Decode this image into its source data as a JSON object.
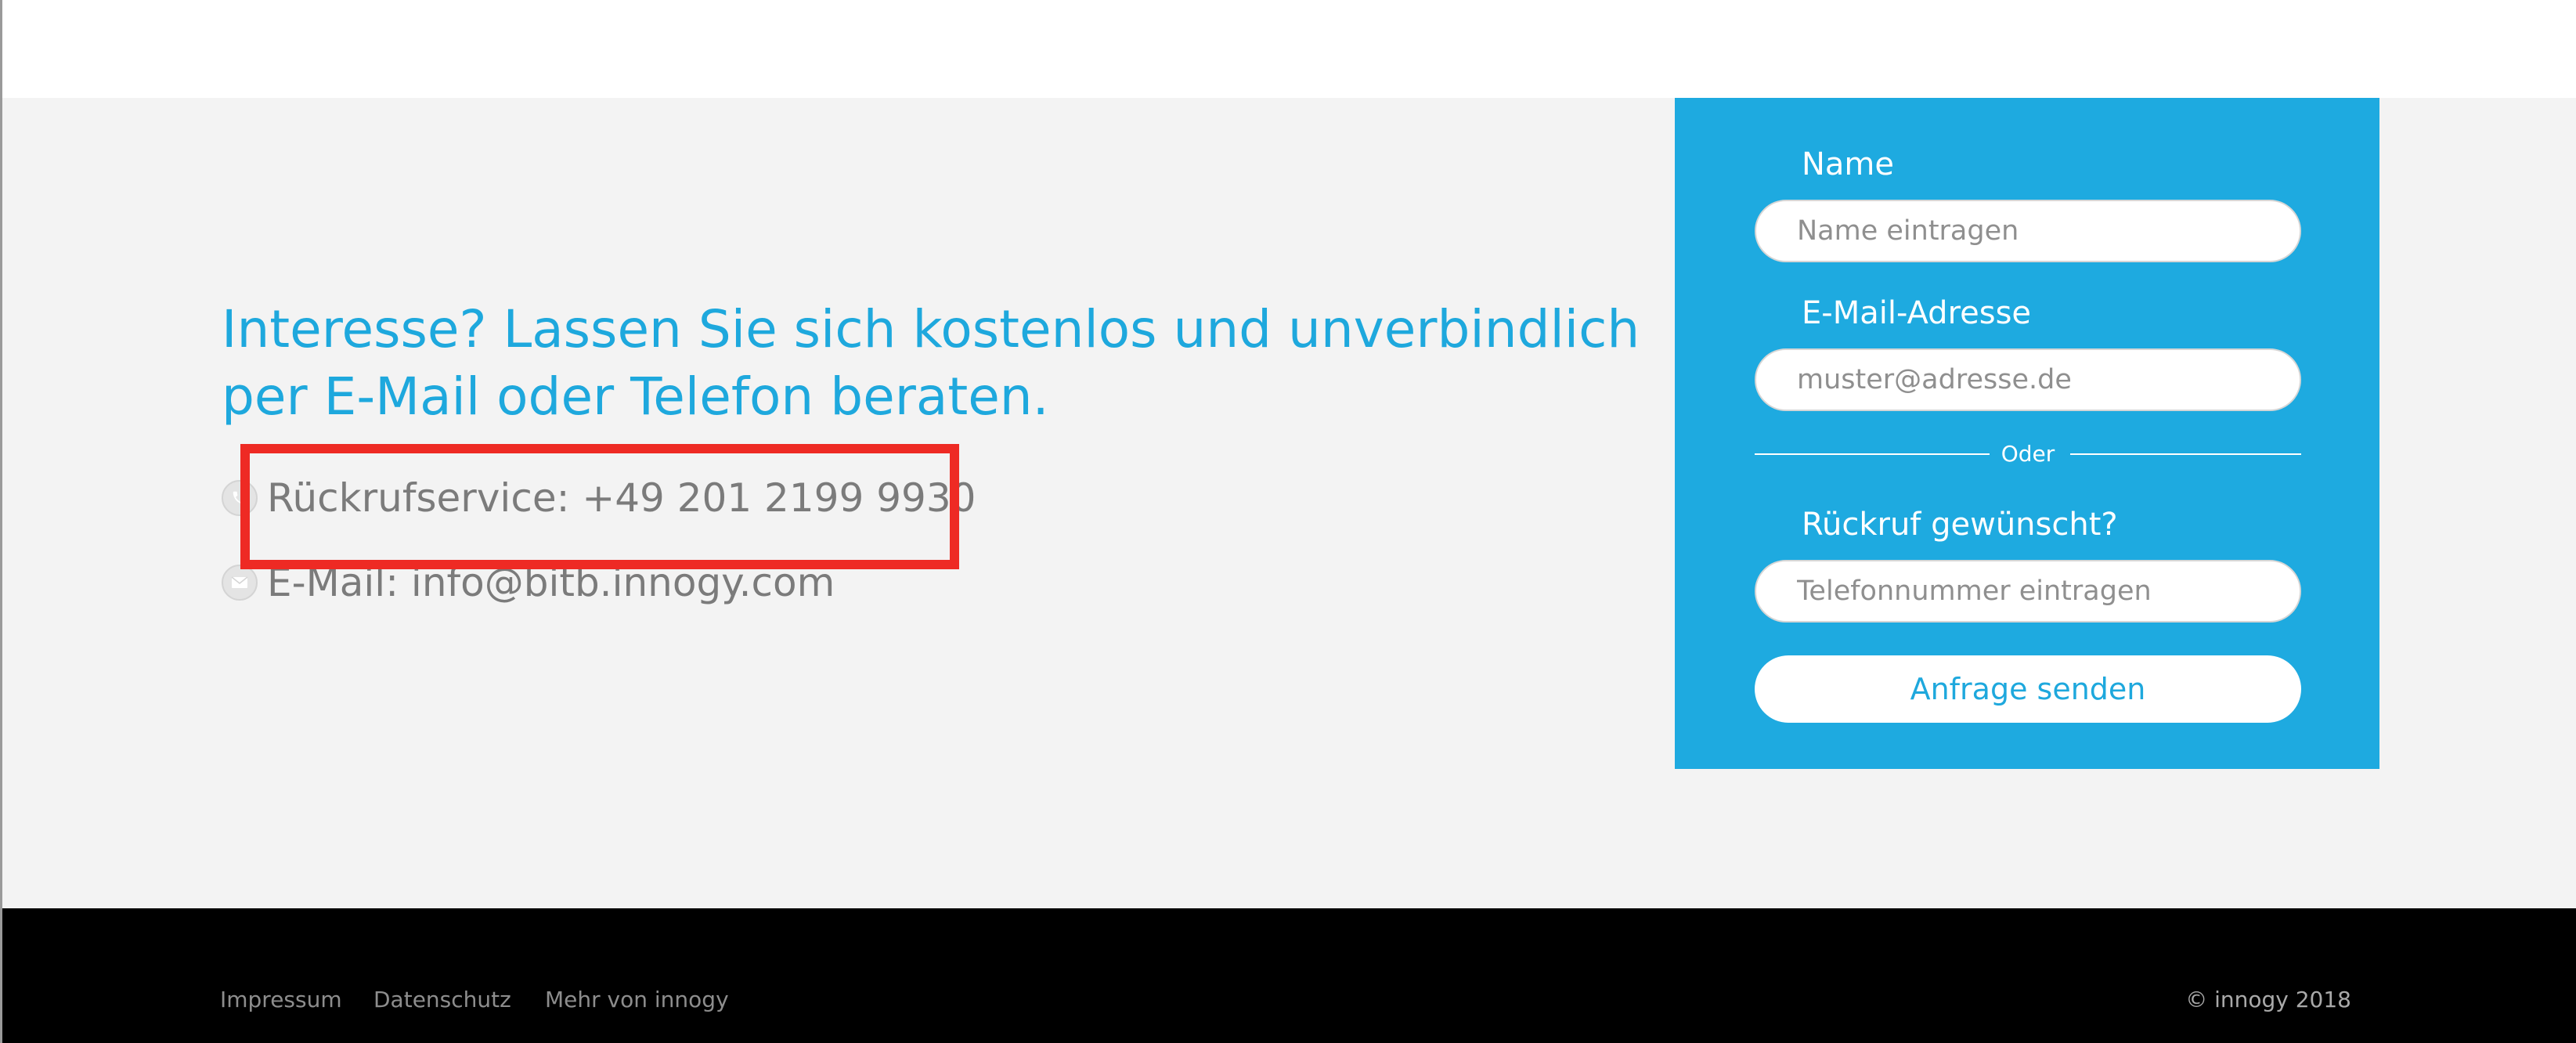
{
  "main": {
    "headline": "Interesse? Lassen Sie sich kostenlos und unverbindlich per E-Mail oder Telefon beraten.",
    "contact": {
      "phone_text": "Rückrufservice: +49 201 2199 9930",
      "phone_icon": "phone-icon",
      "email_text": "E-Mail: info@bitb.innogy.com",
      "email_icon": "envelope-icon"
    }
  },
  "form": {
    "name_label": "Name",
    "name_placeholder": "Name eintragen",
    "email_label": "E-Mail-Adresse",
    "email_placeholder": "muster@adresse.de",
    "divider_text": "Oder",
    "callback_label": "Rückruf gewünscht?",
    "callback_placeholder": "Telefonnummer eintragen",
    "submit_label": "Anfrage senden"
  },
  "footer": {
    "links": [
      "Impressum",
      "Datenschutz",
      "Mehr von innogy"
    ],
    "copyright": "© innogy 2018"
  },
  "colors": {
    "brand_blue": "#1ea8dd",
    "highlight_red": "#ee2a24",
    "footer_bg": "#000000",
    "content_bg": "#f3f3f3"
  }
}
